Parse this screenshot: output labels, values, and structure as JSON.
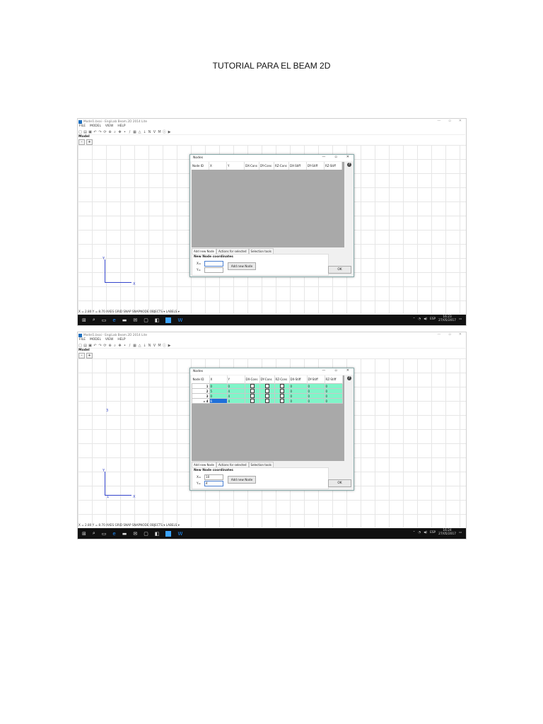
{
  "page_title": "TUTORIAL PARA EL BEAM 2D",
  "app": {
    "title": "Model1.bsai - EngiLab Beam.2D 2014 Lite",
    "menu": [
      "FILE",
      "MODEL",
      "VIEW",
      "HELP"
    ],
    "model_label": "Model",
    "zoom_buttons": [
      "-",
      "+"
    ],
    "status": "X = 2.80 Y = 8.70 AXES GRID SNAP SNAPNODE OBJECTS ▾ LABELS ▾",
    "window_controls": [
      "—",
      "▫",
      "✕"
    ]
  },
  "axes": {
    "x_label": "X",
    "y_label": "Y"
  },
  "dialog": {
    "title": "Nodes",
    "controls": [
      "—",
      "▫",
      "✕"
    ],
    "columns": [
      "Node ID",
      "X",
      "Y",
      "DX-Cons",
      "DY-Cons",
      "RZ-Cons",
      "DX-Stiff",
      "DY-Stiff",
      "RZ-Stiff"
    ],
    "tabs": [
      "Add new Node",
      "Actions for selected",
      "Selection tools"
    ],
    "panel_head": "New Node coordinates",
    "x_label": "X=",
    "y_label": "Y=",
    "add_button": "Add new Node",
    "ok_button": "OK"
  },
  "screenshot1": {
    "x_value": "",
    "y_value": "",
    "rows": []
  },
  "screenshot2": {
    "x_value": "10",
    "y_value": "4",
    "rows": [
      {
        "id": "1",
        "x": "0",
        "y": "0",
        "dx": "0",
        "dy": "0",
        "rz": "0",
        "marker": ""
      },
      {
        "id": "2",
        "x": "5",
        "y": "4",
        "dx": "0",
        "dy": "0",
        "rz": "0",
        "marker": ""
      },
      {
        "id": "3",
        "x": "0",
        "y": "4",
        "dx": "0",
        "dy": "0",
        "rz": "0",
        "marker": ""
      },
      {
        "id": "4",
        "x": "6",
        "y": "4",
        "dx": "0",
        "dy": "0",
        "rz": "0",
        "marker": "▸"
      }
    ],
    "node_labels": [
      "3",
      "1"
    ]
  },
  "taskbar": {
    "time1": "16:23",
    "time2": "16:24",
    "date": "27/05/2017",
    "lang": "ESP"
  }
}
